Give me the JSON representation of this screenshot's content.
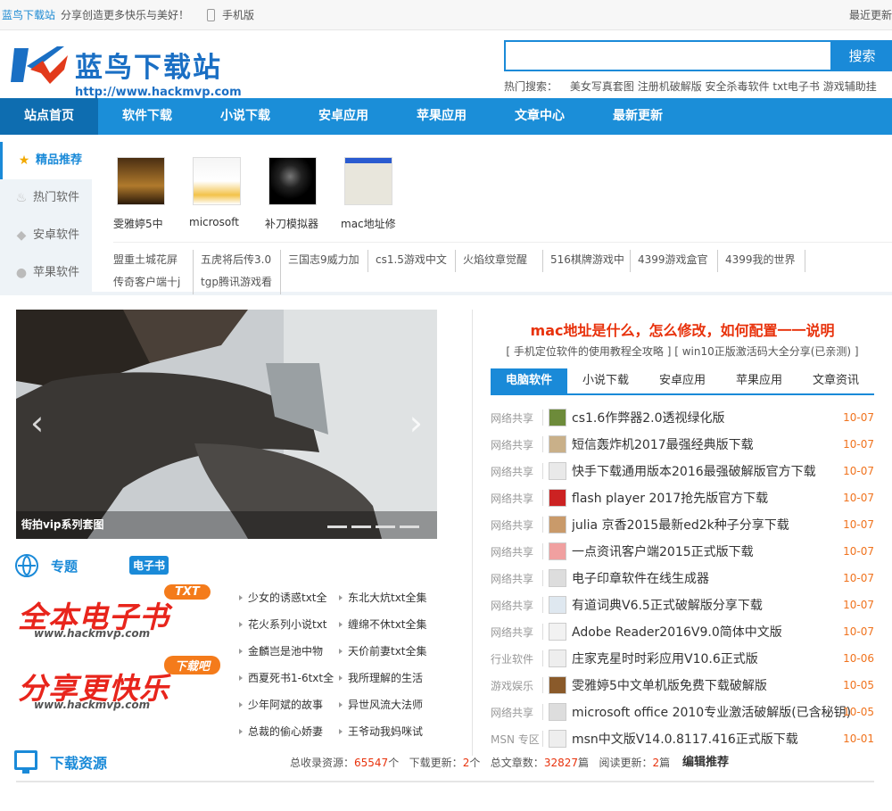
{
  "topbar": {
    "site_name": "蓝鸟下载站",
    "slogan": "分享创造更多快乐与美好！",
    "mobile": "手机版",
    "recent": "最近更新"
  },
  "header": {
    "logo_text": "蓝鸟下载站",
    "logo_url": "http://www.hackmvp.com",
    "search_placeholder": "",
    "search_button": "搜索",
    "hot_label": "热门搜索：",
    "hot_terms": [
      "美女写真套图",
      "注册机破解版",
      "安全杀毒软件",
      "txt电子书",
      "游戏辅助挂"
    ]
  },
  "nav": [
    "站点首页",
    "软件下载",
    "小说下载",
    "安卓应用",
    "苹果应用",
    "文章中心",
    "最新更新"
  ],
  "featured": {
    "side": [
      {
        "icon": "star-icon",
        "label": "精品推荐"
      },
      {
        "icon": "fire-icon",
        "label": "热门软件"
      },
      {
        "icon": "android-icon",
        "label": "安卓软件"
      },
      {
        "icon": "apple-icon",
        "label": "苹果软件"
      }
    ],
    "apps": [
      "雯雅婷5中",
      "microsoft",
      "补刀模拟器",
      "mac地址修"
    ],
    "links": [
      "盟重土城花屏​",
      "五虎将后传3.0",
      "三国志9威力加",
      "cs1.5游戏中文",
      "火焰纹章觉醒",
      "516棋牌游戏中",
      "4399游戏盒官",
      "4399我的世界",
      "传奇客户端十j",
      "tgp腾讯游戏看"
    ]
  },
  "slider": {
    "caption": "街拍vip系列套图"
  },
  "topics": {
    "title": "专题",
    "ebook_badge": "电子书",
    "banner1": {
      "text": "全本电子书",
      "tag": "TXT",
      "url": "www.hackmvp.com"
    },
    "banner2": {
      "text": "分享更快乐",
      "tag": "下载吧",
      "url": "www.hackmvp.com"
    },
    "items": [
      "少女的诱惑txt全",
      "东北大炕txt全集",
      "花火系列小说txt",
      "缠绵不休txt全集",
      "金麟岂是池中物",
      "天价前妻txt全集",
      "西夏死书1-6txt全",
      "我所理解的生活",
      "少年阿斌的故事",
      "异世风流大法师",
      "总裁的偷心娇妻",
      "王爷动我妈咪试"
    ]
  },
  "news": {
    "headline": "mac地址是什么，怎么修改，如何配置一一说明",
    "subline": "[ 手机定位软件的使用教程全攻略 ] [ win10正版激活码大全分享(已亲测) ]",
    "tabs": [
      "电脑软件",
      "小说下载",
      "安卓应用",
      "苹果应用",
      "文章资讯"
    ],
    "rows": [
      {
        "cat": "网络共享",
        "title": "cs1.6作弊器2.0透视绿化版",
        "date": "10-07"
      },
      {
        "cat": "网络共享",
        "title": "短信轰炸机2017最强经典版下载",
        "date": "10-07"
      },
      {
        "cat": "网络共享",
        "title": "快手下载通用版本2016最强破解版官方下载",
        "date": "10-07"
      },
      {
        "cat": "网络共享",
        "title": "flash player 2017抢先版官方下载",
        "date": "10-07"
      },
      {
        "cat": "网络共享",
        "title": "julia 京香2015最新ed2k种子分享下载",
        "date": "10-07"
      },
      {
        "cat": "网络共享",
        "title": "一点资讯客户端2015正式版下载",
        "date": "10-07"
      },
      {
        "cat": "网络共享",
        "title": "电子印章软件在线生成器",
        "date": "10-07"
      },
      {
        "cat": "网络共享",
        "title": "有道词典V6.5正式破解版分享下载",
        "date": "10-07"
      },
      {
        "cat": "网络共享",
        "title": "Adobe Reader2016V9.0简体中文版",
        "date": "10-07"
      },
      {
        "cat": "行业软件",
        "title": "庄家克星时时彩应用V10.6正式版",
        "date": "10-06"
      },
      {
        "cat": "游戏娱乐",
        "title": "雯雅婷5中文单机版免费下载破解版",
        "date": "10-05"
      },
      {
        "cat": "网络共享",
        "title": "microsoft office 2010专业激活破解版(已含秘钥)",
        "date": "10-05"
      },
      {
        "cat": "MSN 专区",
        "title": "msn中文版V14.0.8117.416正式版下载",
        "date": "10-01"
      }
    ]
  },
  "bottom": {
    "title": "下载资源",
    "total_label": "总收录资源：",
    "total": "65547",
    "unit1": "个",
    "dl_label": "下载更新：",
    "dl": "2",
    "unit2": "个",
    "art_label": "总文章数：",
    "art": "32827",
    "unit3": "篇",
    "read_label": "阅读更新：",
    "read": "2",
    "unit4": "篇",
    "editor": "编辑推荐"
  }
}
